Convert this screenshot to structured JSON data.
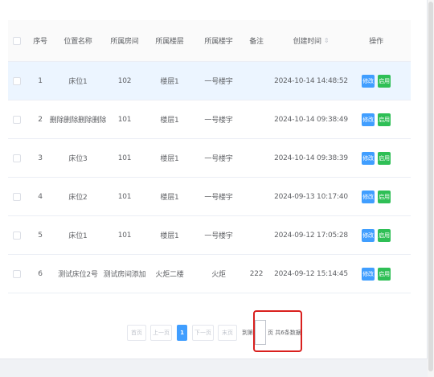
{
  "table": {
    "headers": {
      "index": "序号",
      "location_name": "位置名称",
      "room": "所属房间",
      "floor": "所属楼层",
      "building": "所属楼宇",
      "remark": "备注",
      "created_at": "创建时间",
      "sort_symbol": "⇕",
      "actions": "操作"
    },
    "rows": [
      {
        "index": "1",
        "location_name": "床位1",
        "room": "102",
        "floor": "楼层1",
        "building": "一号楼宇",
        "remark": "",
        "created_at": "2024-10-14 14:48:52",
        "edit": "修改",
        "enable": "启用"
      },
      {
        "index": "2",
        "location_name": "删除删除删除删除",
        "room": "101",
        "floor": "楼层1",
        "building": "一号楼宇",
        "remark": "",
        "created_at": "2024-10-14 09:38:49",
        "edit": "修改",
        "enable": "启用"
      },
      {
        "index": "3",
        "location_name": "床位3",
        "room": "101",
        "floor": "楼层1",
        "building": "一号楼宇",
        "remark": "",
        "created_at": "2024-10-14 09:38:39",
        "edit": "修改",
        "enable": "启用"
      },
      {
        "index": "4",
        "location_name": "床位2",
        "room": "101",
        "floor": "楼层1",
        "building": "一号楼宇",
        "remark": "",
        "created_at": "2024-09-13 10:17:40",
        "edit": "修改",
        "enable": "启用"
      },
      {
        "index": "5",
        "location_name": "床位1",
        "room": "101",
        "floor": "楼层1",
        "building": "一号楼宇",
        "remark": "",
        "created_at": "2024-09-12 17:05:28",
        "edit": "修改",
        "enable": "启用"
      },
      {
        "index": "6",
        "location_name": "测试床位2号",
        "room": "测试房间添加",
        "floor": "火炬二楼",
        "building": "火炬",
        "remark": "222",
        "created_at": "2024-09-12 15:14:45",
        "edit": "修改",
        "enable": "启用"
      }
    ]
  },
  "pagination": {
    "first": "首页",
    "prev": "上一页",
    "current_page": "1",
    "next": "下一页",
    "last": "末页",
    "goto_label": "到第",
    "page_suffix": "页 共",
    "total_count": "6",
    "items_suffix": "条数据"
  },
  "colors": {
    "primary": "#409eff",
    "success": "#2fbf56",
    "highlight_row": "#ecf5ff",
    "annotation": "#d9201e"
  }
}
